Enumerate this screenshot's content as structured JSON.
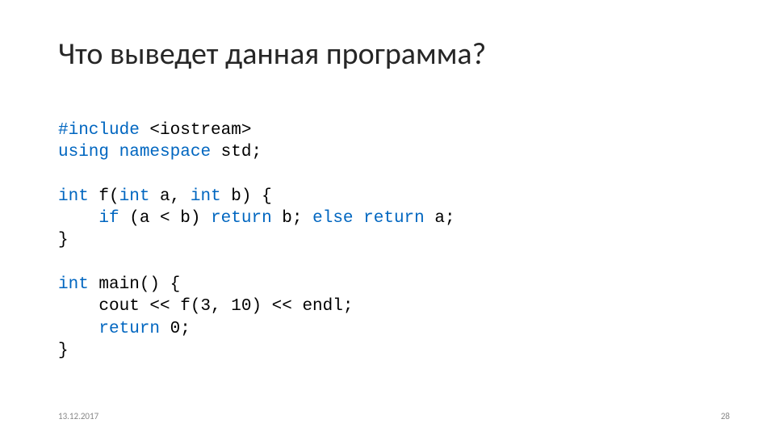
{
  "title": "Что выведет данная программа?",
  "code": {
    "l1a": "#include",
    "l1b": " <iostream>",
    "l2a": "using",
    "l2b": " ",
    "l2c": "namespace",
    "l2d": " std;",
    "l4a": "int",
    "l4b": " f(",
    "l4c": "int",
    "l4d": " a, ",
    "l4e": "int",
    "l4f": " b) {",
    "l5a": "    ",
    "l5b": "if",
    "l5c": " (a < b) ",
    "l5d": "return",
    "l5e": " b; ",
    "l5f": "else",
    "l5g": " ",
    "l5h": "return",
    "l5i": " a;",
    "l6": "}",
    "l8a": "int",
    "l8b": " main() {",
    "l9": "    cout << f(3, 10) << endl;",
    "l10a": "    ",
    "l10b": "return",
    "l10c": " 0;",
    "l11": "}"
  },
  "footer": {
    "date": "13.12.2017",
    "page": "28"
  }
}
